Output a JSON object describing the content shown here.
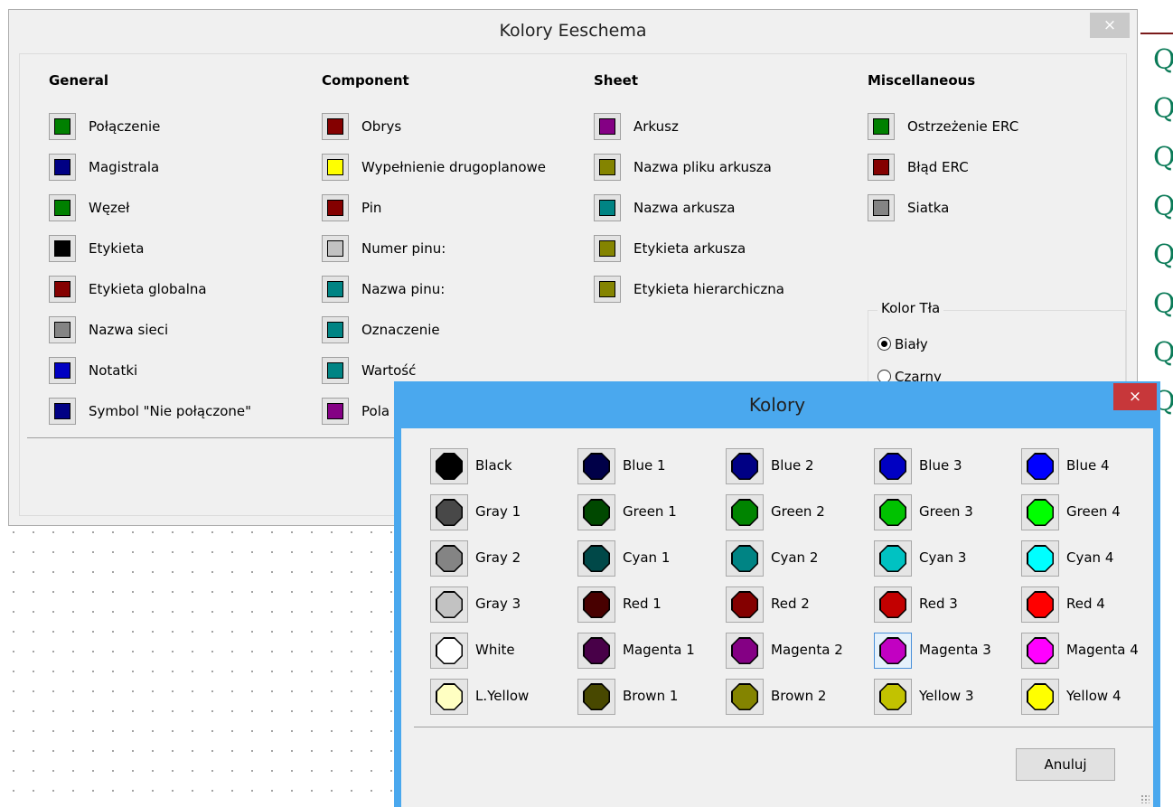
{
  "main_dialog": {
    "title": "Kolory Eeschema",
    "close": "×",
    "columns": [
      {
        "heading": "General",
        "items": [
          {
            "label": "Połączenie",
            "color": "#008000"
          },
          {
            "label": "Magistrala",
            "color": "#000084"
          },
          {
            "label": "Węzeł",
            "color": "#008000"
          },
          {
            "label": "Etykieta",
            "color": "#000000"
          },
          {
            "label": "Etykieta globalna",
            "color": "#840000"
          },
          {
            "label": "Nazwa sieci",
            "color": "#848484"
          },
          {
            "label": "Notatki",
            "color": "#0000c2"
          },
          {
            "label": "Symbol \"Nie połączone\"",
            "color": "#000084"
          }
        ]
      },
      {
        "heading": "Component",
        "items": [
          {
            "label": "Obrys",
            "color": "#840000"
          },
          {
            "label": "Wypełnienie drugoplanowe",
            "color": "#ffff00"
          },
          {
            "label": "Pin",
            "color": "#840000"
          },
          {
            "label": "Numer pinu:",
            "color": "#c2c2c2"
          },
          {
            "label": "Nazwa pinu:",
            "color": "#008484"
          },
          {
            "label": "Oznaczenie",
            "color": "#008484"
          },
          {
            "label": "Wartość",
            "color": "#008484"
          },
          {
            "label": "Pola",
            "color": "#840084"
          }
        ]
      },
      {
        "heading": "Sheet",
        "items": [
          {
            "label": "Arkusz",
            "color": "#840084"
          },
          {
            "label": "Nazwa pliku arkusza",
            "color": "#848400"
          },
          {
            "label": "Nazwa arkusza",
            "color": "#008484"
          },
          {
            "label": "Etykieta arkusza",
            "color": "#848400"
          },
          {
            "label": "Etykieta hierarchiczna",
            "color": "#848400"
          }
        ]
      },
      {
        "heading": "Miscellaneous",
        "items": [
          {
            "label": "Ostrzeżenie ERC",
            "color": "#008000"
          },
          {
            "label": "Błąd ERC",
            "color": "#840000"
          },
          {
            "label": "Siatka",
            "color": "#848484"
          }
        ]
      }
    ],
    "background": {
      "legend": "Kolor Tła",
      "options": [
        {
          "label": "Biały",
          "selected": true
        },
        {
          "label": "Czarny",
          "selected": false
        }
      ]
    }
  },
  "colors_dialog": {
    "title": "Kolory",
    "close": "×",
    "cancel_label": "Anuluj",
    "selected": "Magenta 3",
    "rows": [
      [
        {
          "name": "Black",
          "color": "#000000"
        },
        {
          "name": "Blue 1",
          "color": "#000048"
        },
        {
          "name": "Blue 2",
          "color": "#000084"
        },
        {
          "name": "Blue 3",
          "color": "#0000c2"
        },
        {
          "name": "Blue 4",
          "color": "#0000ff"
        }
      ],
      [
        {
          "name": "Gray 1",
          "color": "#484848"
        },
        {
          "name": "Green 1",
          "color": "#004800"
        },
        {
          "name": "Green 2",
          "color": "#008400"
        },
        {
          "name": "Green 3",
          "color": "#00c200"
        },
        {
          "name": "Green 4",
          "color": "#00ff00"
        }
      ],
      [
        {
          "name": "Gray 2",
          "color": "#848484"
        },
        {
          "name": "Cyan 1",
          "color": "#004848"
        },
        {
          "name": "Cyan 2",
          "color": "#008484"
        },
        {
          "name": "Cyan 3",
          "color": "#00c2c2"
        },
        {
          "name": "Cyan 4",
          "color": "#00ffff"
        }
      ],
      [
        {
          "name": "Gray 3",
          "color": "#c2c2c2"
        },
        {
          "name": "Red 1",
          "color": "#480000"
        },
        {
          "name": "Red 2",
          "color": "#840000"
        },
        {
          "name": "Red 3",
          "color": "#c20000"
        },
        {
          "name": "Red 4",
          "color": "#ff0000"
        }
      ],
      [
        {
          "name": "White",
          "color": "#ffffff"
        },
        {
          "name": "Magenta 1",
          "color": "#480048"
        },
        {
          "name": "Magenta 2",
          "color": "#840084"
        },
        {
          "name": "Magenta 3",
          "color": "#c200c2"
        },
        {
          "name": "Magenta 4",
          "color": "#ff00ff"
        }
      ],
      [
        {
          "name": "L.Yellow",
          "color": "#ffffc2"
        },
        {
          "name": "Brown 1",
          "color": "#484800"
        },
        {
          "name": "Brown 2",
          "color": "#848400"
        },
        {
          "name": "Yellow 3",
          "color": "#c2c200"
        },
        {
          "name": "Yellow 4",
          "color": "#ffff00"
        }
      ]
    ]
  },
  "schematic": {
    "symbol_glyph": "Q"
  }
}
